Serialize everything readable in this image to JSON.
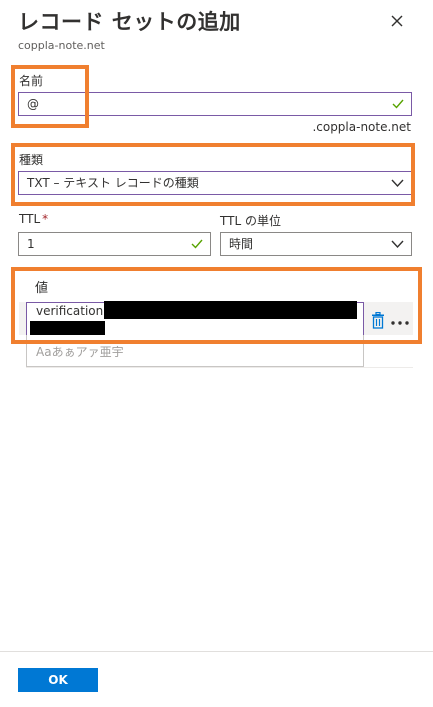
{
  "panel": {
    "title": "レコード セットの追加",
    "subtitle": "coppla-note.net",
    "close_icon": "close-icon"
  },
  "name_field": {
    "label": "名前",
    "value": "@",
    "suffix": ".coppla-note.net",
    "valid": true
  },
  "type_field": {
    "label": "種類",
    "selected": "TXT – テキスト レコードの種類"
  },
  "ttl_field": {
    "label": "TTL",
    "required_mark": "*",
    "value": "1",
    "valid": true
  },
  "ttl_unit_field": {
    "label": "TTL の単位",
    "selected": "時間"
  },
  "value_section": {
    "label": "値",
    "row_value": "verification=",
    "placeholder": "Aaあぁアァ亜宇",
    "delete_icon": "trash-icon",
    "more_icon": "more-icon"
  },
  "footer": {
    "ok_label": "OK"
  },
  "colors": {
    "accent": "#0078d4",
    "highlight_border": "#f07f2f",
    "focus_border": "#7a5aa6",
    "valid_check": "#57a300"
  }
}
